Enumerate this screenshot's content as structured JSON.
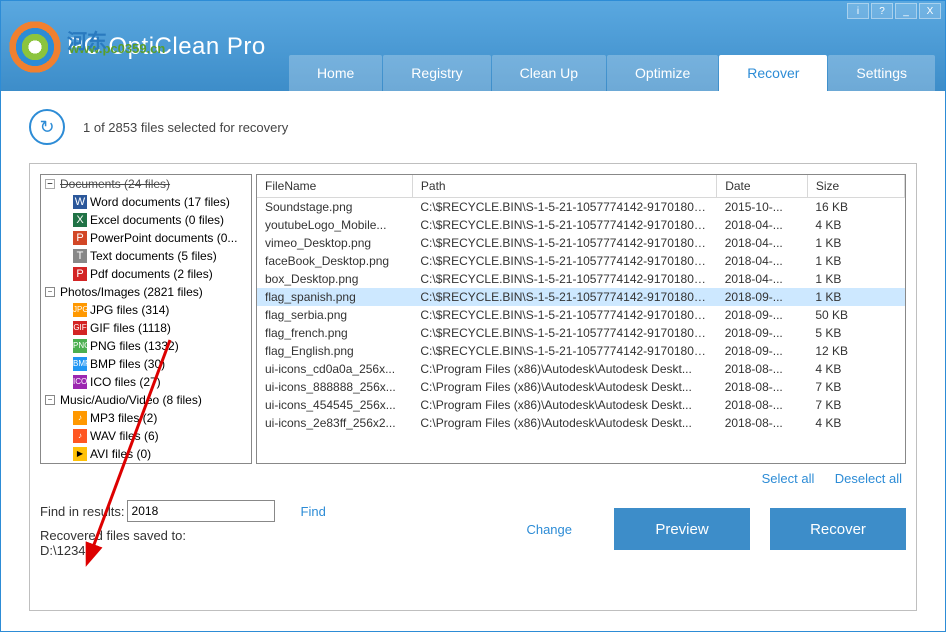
{
  "titlebar": {
    "info": "i",
    "help": "?",
    "min": "_",
    "close": "X"
  },
  "app": {
    "overlay_text": "河东",
    "title": "PC OptiClean Pro",
    "sub": "www.pc0359.cn"
  },
  "tabs": [
    {
      "label": "Home"
    },
    {
      "label": "Registry"
    },
    {
      "label": "Clean Up"
    },
    {
      "label": "Optimize"
    },
    {
      "label": "Recover",
      "active": true
    },
    {
      "label": "Settings"
    }
  ],
  "status": "1 of 2853 files selected for recovery",
  "tree": {
    "doc_header": "Documents (24 files)",
    "docs": [
      {
        "icon": "ic-word",
        "glyph": "W",
        "label": "Word documents (17 files)"
      },
      {
        "icon": "ic-excel",
        "glyph": "X",
        "label": "Excel documents (0 files)"
      },
      {
        "icon": "ic-ppt",
        "glyph": "P",
        "label": "PowerPoint documents (0..."
      },
      {
        "icon": "ic-txt",
        "glyph": "T",
        "label": "Text documents (5 files)"
      },
      {
        "icon": "ic-pdf",
        "glyph": "P",
        "label": "Pdf documents (2 files)"
      }
    ],
    "photos_header": "Photos/Images (2821 files)",
    "photos": [
      {
        "icon": "ic-jpg",
        "glyph": "JPG",
        "label": "JPG files (314)"
      },
      {
        "icon": "ic-gif",
        "glyph": "GIF",
        "label": "GIF files (1118)"
      },
      {
        "icon": "ic-png",
        "glyph": "PNG",
        "label": "PNG files (1332)"
      },
      {
        "icon": "ic-bmp",
        "glyph": "BMP",
        "label": "BMP files (30)"
      },
      {
        "icon": "ic-ico",
        "glyph": "ICO",
        "label": "ICO files (27)"
      }
    ],
    "media_header": "Music/Audio/Video (8 files)",
    "media": [
      {
        "icon": "ic-mp3",
        "glyph": "♪",
        "label": "MP3 files (2)"
      },
      {
        "icon": "ic-wav",
        "glyph": "♪",
        "label": "WAV files (6)"
      },
      {
        "icon": "ic-avi",
        "glyph": "▶",
        "label": "AVI files (0)"
      }
    ]
  },
  "table": {
    "headers": {
      "name": "FileName",
      "path": "Path",
      "date": "Date",
      "size": "Size"
    },
    "rows": [
      {
        "name": "Soundstage.png",
        "path": "C:\\$RECYCLE.BIN\\S-1-5-21-1057774142-91701807...",
        "date": "2015-10-...",
        "size": "16 KB"
      },
      {
        "name": "youtubeLogo_Mobile...",
        "path": "C:\\$RECYCLE.BIN\\S-1-5-21-1057774142-91701807...",
        "date": "2018-04-...",
        "size": "4 KB"
      },
      {
        "name": "vimeo_Desktop.png",
        "path": "C:\\$RECYCLE.BIN\\S-1-5-21-1057774142-91701807...",
        "date": "2018-04-...",
        "size": "1 KB"
      },
      {
        "name": "faceBook_Desktop.png",
        "path": "C:\\$RECYCLE.BIN\\S-1-5-21-1057774142-91701807...",
        "date": "2018-04-...",
        "size": "1 KB"
      },
      {
        "name": "box_Desktop.png",
        "path": "C:\\$RECYCLE.BIN\\S-1-5-21-1057774142-91701807...",
        "date": "2018-04-...",
        "size": "1 KB"
      },
      {
        "name": "flag_spanish.png",
        "path": "C:\\$RECYCLE.BIN\\S-1-5-21-1057774142-91701807...",
        "date": "2018-09-...",
        "size": "1 KB",
        "selected": true
      },
      {
        "name": "flag_serbia.png",
        "path": "C:\\$RECYCLE.BIN\\S-1-5-21-1057774142-91701807...",
        "date": "2018-09-...",
        "size": "50 KB"
      },
      {
        "name": "flag_french.png",
        "path": "C:\\$RECYCLE.BIN\\S-1-5-21-1057774142-91701807...",
        "date": "2018-09-...",
        "size": "5 KB"
      },
      {
        "name": "flag_English.png",
        "path": "C:\\$RECYCLE.BIN\\S-1-5-21-1057774142-91701807...",
        "date": "2018-09-...",
        "size": "12 KB"
      },
      {
        "name": "ui-icons_cd0a0a_256x...",
        "path": "C:\\Program Files (x86)\\Autodesk\\Autodesk Deskt...",
        "date": "2018-08-...",
        "size": "4 KB"
      },
      {
        "name": "ui-icons_888888_256x...",
        "path": "C:\\Program Files (x86)\\Autodesk\\Autodesk Deskt...",
        "date": "2018-08-...",
        "size": "7 KB"
      },
      {
        "name": "ui-icons_454545_256x...",
        "path": "C:\\Program Files (x86)\\Autodesk\\Autodesk Deskt...",
        "date": "2018-08-...",
        "size": "7 KB"
      },
      {
        "name": "ui-icons_2e83ff_256x2...",
        "path": "C:\\Program Files (x86)\\Autodesk\\Autodesk Deskt...",
        "date": "2018-08-...",
        "size": "4 KB"
      }
    ]
  },
  "links": {
    "select_all": "Select all",
    "deselect_all": "Deselect all"
  },
  "footer": {
    "find_label": "Find in results:",
    "find_value": "2018",
    "find_btn": "Find",
    "saved_label": "Recovered files saved to:",
    "saved_path": "D:\\12345",
    "change": "Change",
    "preview": "Preview",
    "recover": "Recover"
  }
}
